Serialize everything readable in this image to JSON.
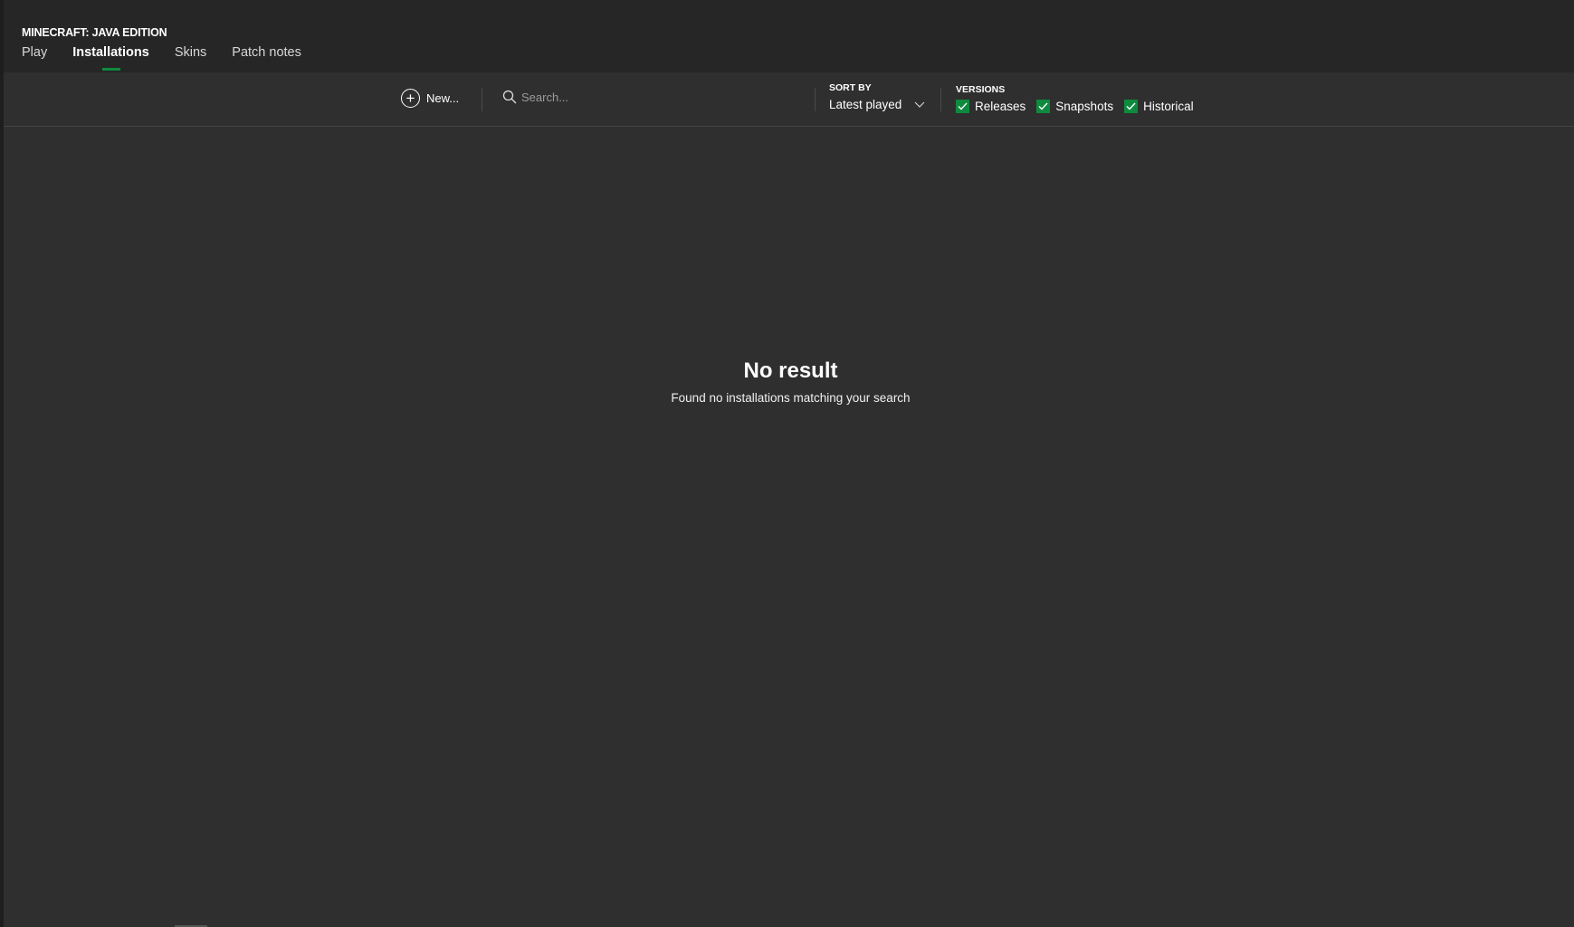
{
  "app": {
    "title": "MINECRAFT: JAVA EDITION"
  },
  "tabs": [
    {
      "label": "Play"
    },
    {
      "label": "Installations"
    },
    {
      "label": "Skins"
    },
    {
      "label": "Patch notes"
    }
  ],
  "toolbar": {
    "new_label": "New...",
    "search_placeholder": "Search...",
    "sort_label": "SORT BY",
    "sort_value": "Latest played",
    "versions_label": "VERSIONS",
    "versions": [
      {
        "label": "Releases",
        "checked": true
      },
      {
        "label": "Snapshots",
        "checked": true
      },
      {
        "label": "Historical",
        "checked": true
      }
    ]
  },
  "empty": {
    "title": "No result",
    "message": "Found no installations matching your search"
  },
  "colors": {
    "accent": "#0e8a3f"
  }
}
